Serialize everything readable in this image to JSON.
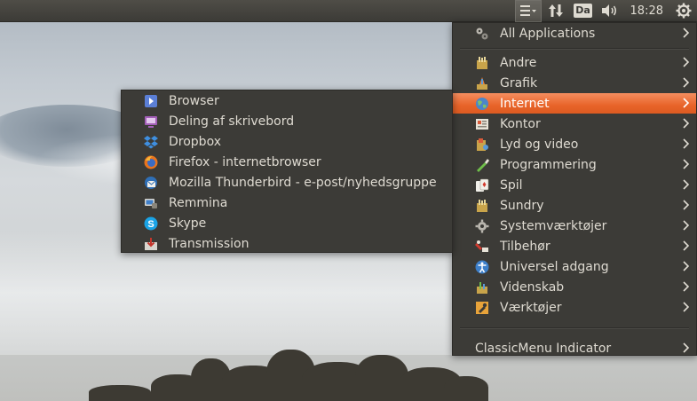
{
  "panel": {
    "clock": "18:28",
    "keyboard_layout": "Da",
    "icons": [
      "classicmenu-indicator-icon",
      "network-transfer-icon",
      "keyboard-layout-icon",
      "volume-icon",
      "session-gear-icon"
    ]
  },
  "main_menu": {
    "all_applications": "All Applications",
    "categories": [
      {
        "label": "Andre",
        "icon": "folder-misc-icon",
        "submenu": true
      },
      {
        "label": "Grafik",
        "icon": "graphics-icon",
        "submenu": true
      },
      {
        "label": "Internet",
        "icon": "internet-globe-icon",
        "submenu": true,
        "highlighted": true
      },
      {
        "label": "Kontor",
        "icon": "office-icon",
        "submenu": true
      },
      {
        "label": "Lyd og video",
        "icon": "multimedia-icon",
        "submenu": true
      },
      {
        "label": "Programmering",
        "icon": "programming-icon",
        "submenu": true
      },
      {
        "label": "Spil",
        "icon": "games-cards-icon",
        "submenu": true
      },
      {
        "label": "Sundry",
        "icon": "sundry-icon",
        "submenu": true
      },
      {
        "label": "Systemværktøjer",
        "icon": "system-gear-icon",
        "submenu": true
      },
      {
        "label": "Tilbehør",
        "icon": "accessories-icon",
        "submenu": true
      },
      {
        "label": "Universel adgang",
        "icon": "accessibility-icon",
        "submenu": true
      },
      {
        "label": "Videnskab",
        "icon": "science-icon",
        "submenu": true
      },
      {
        "label": "Værktøjer",
        "icon": "tools-icon",
        "submenu": true
      }
    ],
    "footer": "ClassicMenu Indicator"
  },
  "internet_submenu": {
    "items": [
      {
        "label": "Browser",
        "icon": "browser-icon"
      },
      {
        "label": "Deling af skrivebord",
        "icon": "desktop-sharing-icon"
      },
      {
        "label": "Dropbox",
        "icon": "dropbox-icon"
      },
      {
        "label": "Firefox - internetbrowser",
        "icon": "firefox-icon"
      },
      {
        "label": "Mozilla Thunderbird - e-post/nyhedsgruppe",
        "icon": "thunderbird-icon"
      },
      {
        "label": "Remmina",
        "icon": "remmina-icon"
      },
      {
        "label": "Skype",
        "icon": "skype-icon"
      },
      {
        "label": "Transmission",
        "icon": "transmission-icon"
      }
    ]
  },
  "colors": {
    "panel": "#3c3b37",
    "menu_bg": "#3c3b37",
    "menu_text": "#dfdbd2",
    "highlight": "#e8642a"
  }
}
